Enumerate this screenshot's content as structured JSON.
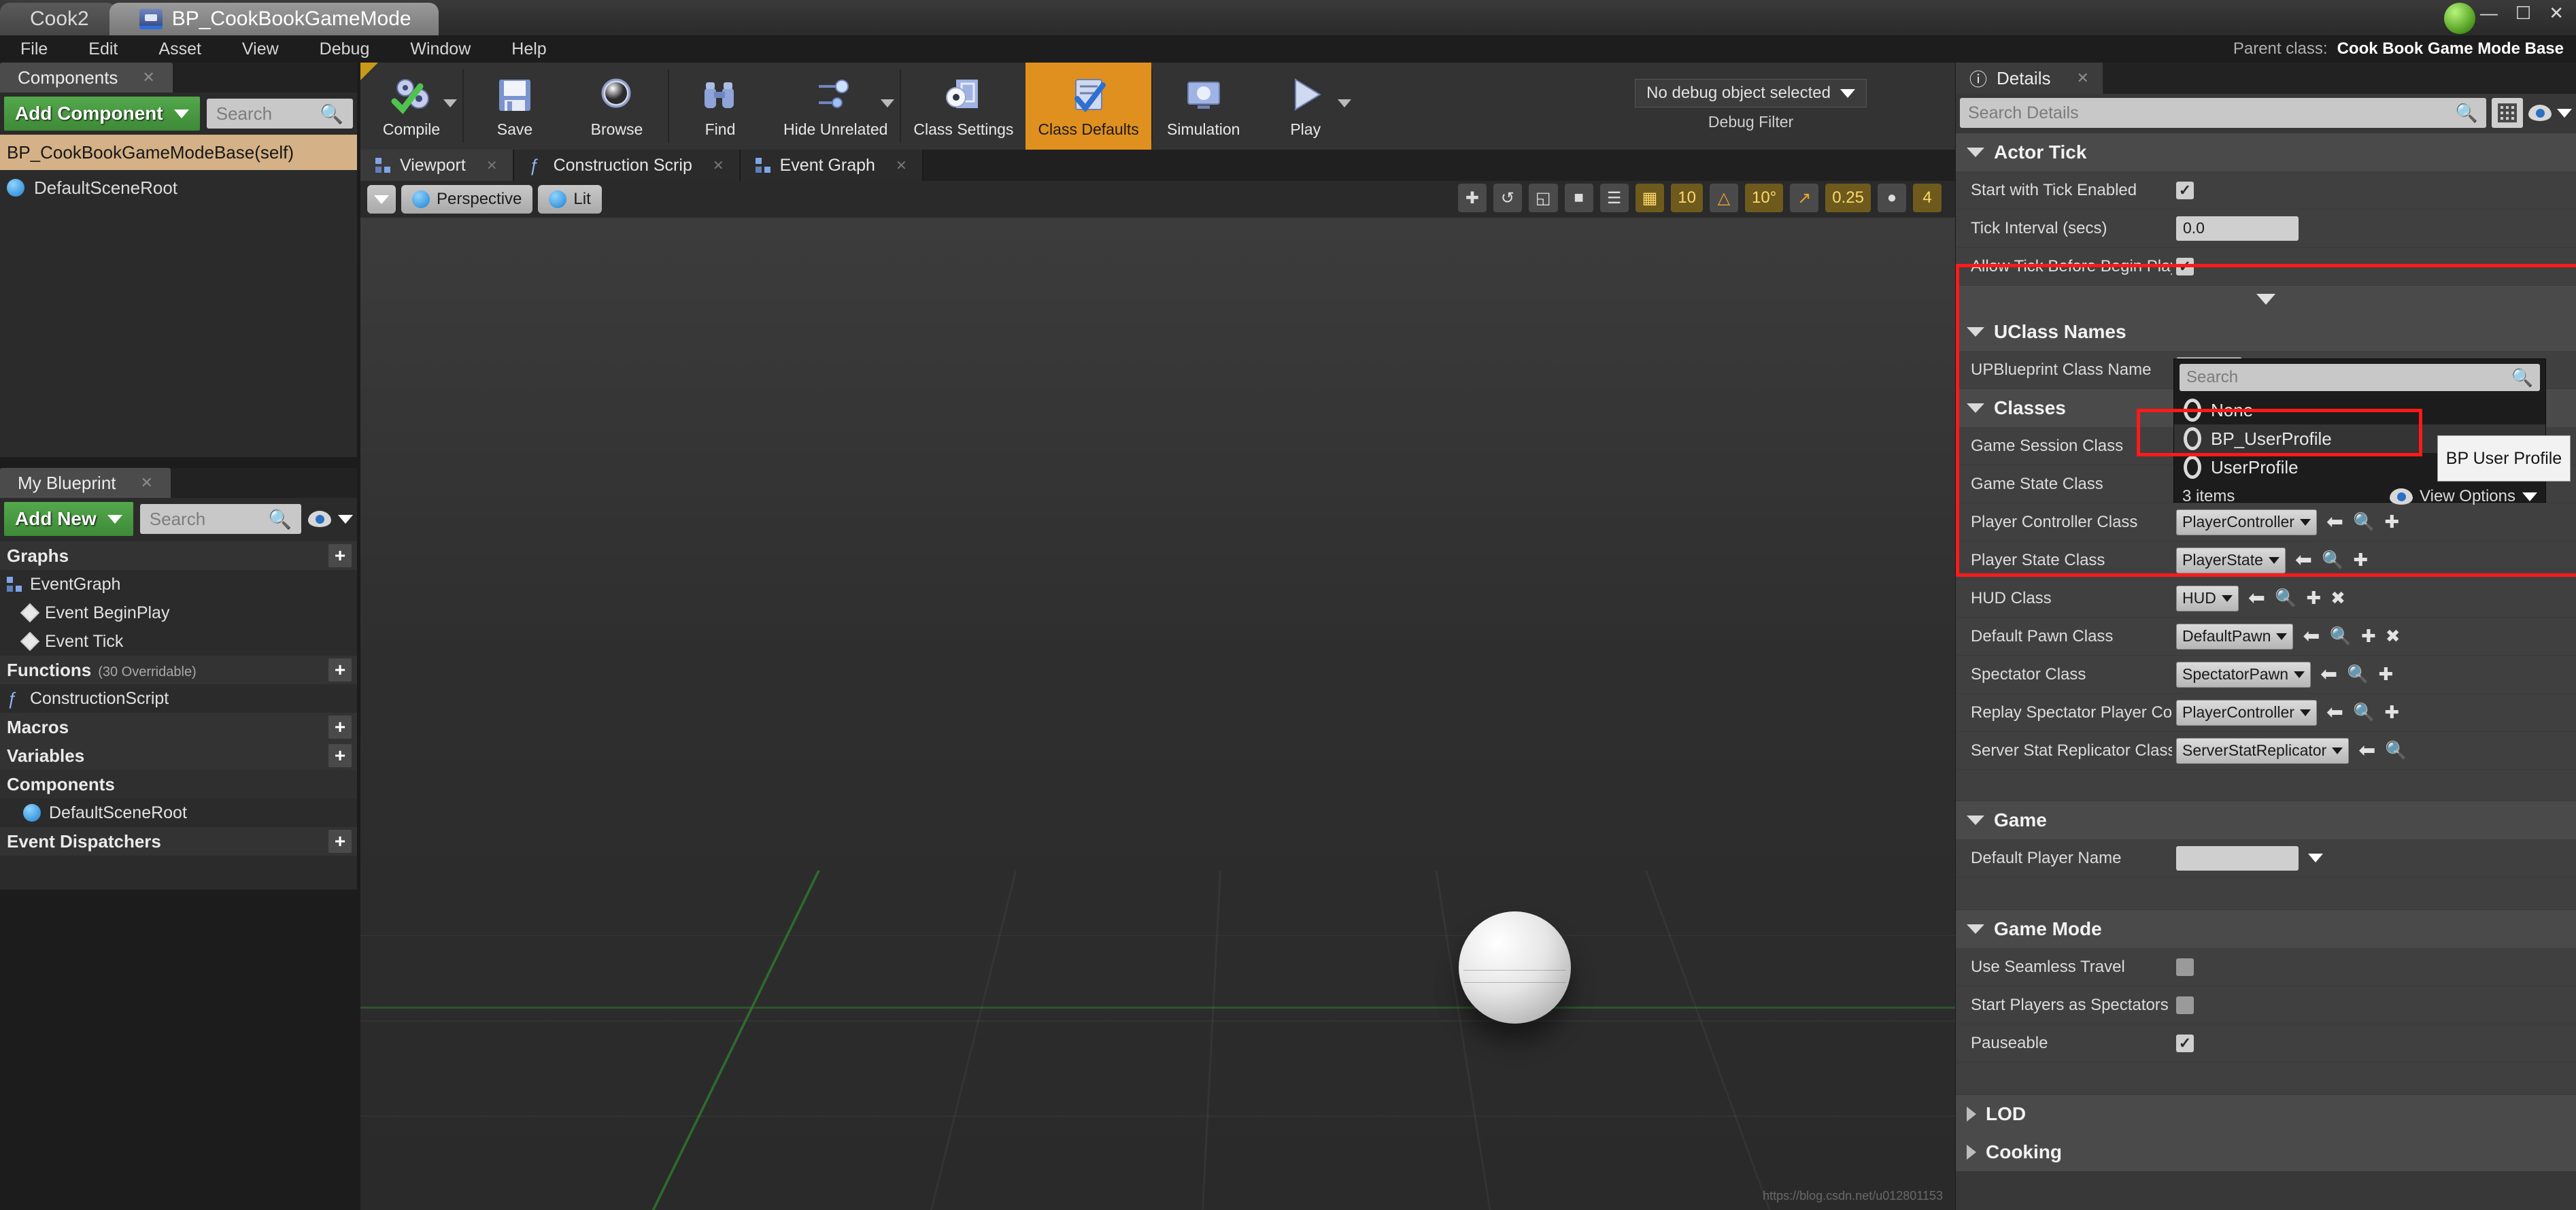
{
  "window": {
    "tabs": [
      {
        "label": "Cook2",
        "active": false,
        "icon": "none"
      },
      {
        "label": "BP_CookBookGameMode",
        "active": true,
        "icon": "blueprint-icon"
      }
    ],
    "controls": {
      "minimize": "—",
      "maximize": "☐",
      "close": "✕"
    }
  },
  "menubar": {
    "items": [
      "File",
      "Edit",
      "Asset",
      "View",
      "Debug",
      "Window",
      "Help"
    ],
    "parent_class_label": "Parent class:",
    "parent_class_value": "Cook Book Game Mode Base"
  },
  "components_panel": {
    "tab_label": "Components",
    "close_label": "✕",
    "add_component_label": "Add Component",
    "search_placeholder": "Search",
    "items": [
      {
        "label": "BP_CookBookGameModeBase(self)",
        "selected": true
      },
      {
        "label": "DefaultSceneRoot",
        "selected": false
      }
    ]
  },
  "my_blueprint": {
    "tab_label": "My Blueprint",
    "close_label": "✕",
    "add_new_label": "Add New",
    "search_placeholder": "Search",
    "sections": [
      {
        "title": "Graphs",
        "sub": "",
        "plus": "+",
        "items": [
          {
            "label": "EventGraph",
            "icon": "graph-icon",
            "indent": 0
          },
          {
            "label": "Event BeginPlay",
            "icon": "event-node-icon",
            "indent": 1
          },
          {
            "label": "Event Tick",
            "icon": "event-node-icon",
            "indent": 1
          }
        ]
      },
      {
        "title": "Functions",
        "sub": "(30 Overridable)",
        "plus": "+",
        "items": [
          {
            "label": "ConstructionScript",
            "icon": "function-icon",
            "indent": 0
          }
        ]
      },
      {
        "title": "Macros",
        "sub": "",
        "plus": "+",
        "items": []
      },
      {
        "title": "Variables",
        "sub": "",
        "plus": "+",
        "items": []
      },
      {
        "title": "Components",
        "sub": "",
        "plus": "",
        "items": [
          {
            "label": "DefaultSceneRoot",
            "icon": "scene-root-icon",
            "indent": 1
          }
        ]
      },
      {
        "title": "Event Dispatchers",
        "sub": "",
        "plus": "+",
        "items": []
      }
    ]
  },
  "toolbar": {
    "buttons": [
      {
        "label": "Compile",
        "icon": "compile-gears-icon",
        "has_arrow": true,
        "active": false
      },
      {
        "label": "Save",
        "icon": "save-floppy-icon",
        "has_arrow": false,
        "active": false
      },
      {
        "label": "Browse",
        "icon": "browse-sphere-icon",
        "has_arrow": false,
        "active": false
      },
      {
        "label": "Find",
        "icon": "find-binoculars-icon",
        "has_arrow": false,
        "active": false
      },
      {
        "label": "Hide Unrelated",
        "icon": "hide-unrelated-icon",
        "has_arrow": true,
        "active": false
      },
      {
        "label": "Class Settings",
        "icon": "class-settings-icon",
        "has_arrow": false,
        "active": false
      },
      {
        "label": "Class Defaults",
        "icon": "class-defaults-icon",
        "has_arrow": false,
        "active": true
      },
      {
        "label": "Simulation",
        "icon": "simulation-icon",
        "has_arrow": false,
        "active": false
      },
      {
        "label": "Play",
        "icon": "play-icon",
        "has_arrow": true,
        "active": false
      }
    ],
    "debug_object_label": "No debug object selected",
    "debug_filter_label": "Debug Filter"
  },
  "viewport": {
    "tabs": [
      {
        "label": "Viewport",
        "icon": "viewport-icon",
        "active": true
      },
      {
        "label": "Construction Scrip",
        "icon": "function-icon",
        "active": false
      },
      {
        "label": "Event Graph",
        "icon": "graph-icon",
        "active": false
      }
    ],
    "view_mode": "Perspective",
    "lit_mode": "Lit",
    "tools": [
      {
        "name": "translate-snap",
        "value": "10"
      },
      {
        "name": "rotation-snap",
        "value": "10°"
      },
      {
        "name": "scale-snap",
        "value": "0.25"
      },
      {
        "name": "camera-speed",
        "value": "4"
      }
    ],
    "watermark": "https://blog.csdn.net/u012801153"
  },
  "details": {
    "tab_label": "Details",
    "close_label": "✕",
    "search_placeholder": "Search Details",
    "categories": [
      {
        "title": "Actor Tick",
        "open": true,
        "rows": [
          {
            "name": "Start with Tick Enabled",
            "type": "checkbox",
            "checked": true
          },
          {
            "name": "Tick Interval (secs)",
            "type": "number",
            "value": "0.0"
          },
          {
            "name": "Allow Tick Before Begin Play",
            "type": "checkbox",
            "checked": true
          }
        ]
      },
      {
        "title": "UClass Names",
        "open": true,
        "rows": [
          {
            "name": "UPBlueprint Class Name",
            "type": "class",
            "value": "None",
            "actions": [
              "back-arrow-icon",
              "browse-icon",
              "plus-icon",
              "clear-icon"
            ]
          }
        ]
      },
      {
        "title": "Classes",
        "open": true,
        "rows": [
          {
            "name": "Game Session Class",
            "type": "class",
            "value": "",
            "actions": []
          },
          {
            "name": "Game State Class",
            "type": "class",
            "value": "",
            "actions": []
          },
          {
            "name": "Player Controller Class",
            "type": "class",
            "value": "PlayerController",
            "actions": [
              "back-arrow-icon",
              "browse-icon",
              "plus-icon"
            ]
          },
          {
            "name": "Player State Class",
            "type": "class",
            "value": "PlayerState",
            "actions": [
              "back-arrow-icon",
              "browse-icon",
              "plus-icon"
            ]
          },
          {
            "name": "HUD Class",
            "type": "class",
            "value": "HUD",
            "actions": [
              "back-arrow-icon",
              "browse-icon",
              "plus-icon",
              "clear-icon"
            ]
          },
          {
            "name": "Default Pawn Class",
            "type": "class",
            "value": "DefaultPawn",
            "actions": [
              "back-arrow-icon",
              "browse-icon",
              "plus-icon",
              "clear-icon"
            ]
          },
          {
            "name": "Spectator Class",
            "type": "class",
            "value": "SpectatorPawn",
            "actions": [
              "back-arrow-icon",
              "browse-icon",
              "plus-icon"
            ]
          },
          {
            "name": "Replay Spectator Player Cont",
            "type": "class",
            "value": "PlayerController",
            "actions": [
              "back-arrow-icon",
              "browse-icon",
              "plus-icon"
            ]
          },
          {
            "name": "Server Stat Replicator Class",
            "type": "class",
            "value": "ServerStatReplicator",
            "actions": [
              "back-arrow-icon",
              "browse-icon"
            ]
          }
        ]
      },
      {
        "title": "Game",
        "open": true,
        "rows": [
          {
            "name": "Default Player Name",
            "type": "text",
            "value": ""
          }
        ]
      },
      {
        "title": "Game Mode",
        "open": true,
        "rows": [
          {
            "name": "Use Seamless Travel",
            "type": "checkbox",
            "checked": false
          },
          {
            "name": "Start Players as Spectators",
            "type": "checkbox",
            "checked": false
          },
          {
            "name": "Pauseable",
            "type": "checkbox",
            "checked": true
          }
        ]
      },
      {
        "title": "LOD",
        "open": false,
        "rows": []
      },
      {
        "title": "Cooking",
        "open": false,
        "rows": []
      }
    ]
  },
  "class_picker_dropdown": {
    "search_placeholder": "Search",
    "options": [
      {
        "label": "None",
        "highlighted": false
      },
      {
        "label": "BP_UserProfile",
        "highlighted": true
      },
      {
        "label": "UserProfile",
        "highlighted": false
      }
    ],
    "count_label": "3 items",
    "view_options_label": "View Options"
  },
  "tooltip": {
    "text": "BP User Profile"
  },
  "annotations": {
    "highlight_color": "#ff1a1a"
  }
}
